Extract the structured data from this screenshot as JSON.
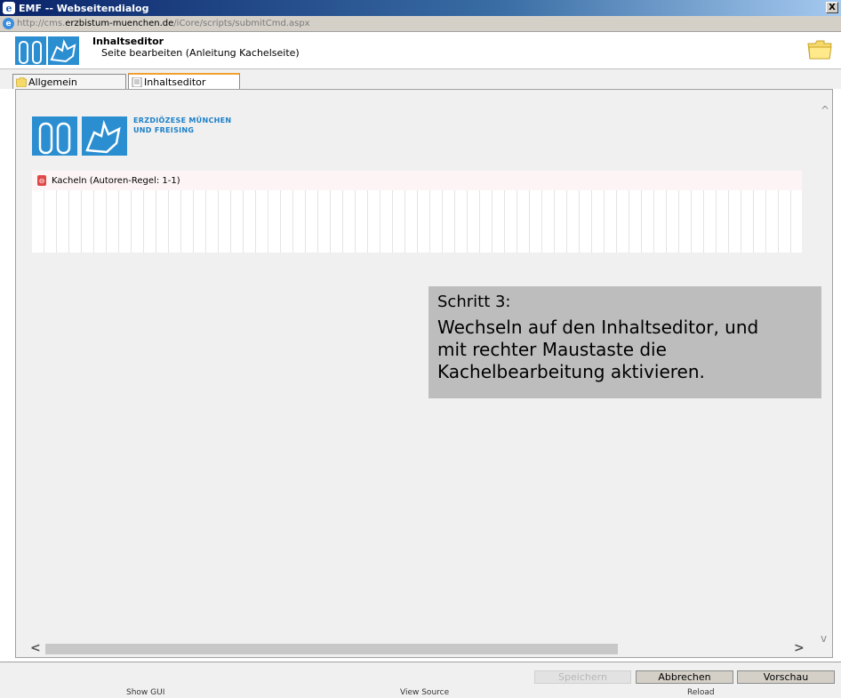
{
  "window": {
    "title": "EMF -- Webseitendialog",
    "close_glyph": "X",
    "url_prefix": "http://cms.",
    "url_domain": "erzbistum-muenchen.de",
    "url_path": "/iCore/scripts/submitCmd.aspx"
  },
  "header": {
    "title": "Inhaltseditor",
    "subtitle": "Seite bearbeiten (Anleitung Kachelseite)"
  },
  "tabs": [
    {
      "label": "Allgemein",
      "icon": "folder-icon"
    },
    {
      "label": "Inhaltseditor",
      "icon": "document-icon"
    }
  ],
  "content": {
    "org_line1": "ERZDIÖZESE MÜNCHEN",
    "org_line2": "UND FREISING",
    "tiles_label": "Kacheln (Autoren-Regel: 1-1)"
  },
  "overlay": {
    "title": "Schritt 3:",
    "body_line1": "Wechseln auf den Inhaltseditor, und",
    "body_line2": "mit rechter Maustaste die",
    "body_line3": "Kachelbearbeitung aktivieren."
  },
  "buttons": {
    "save": "Speichern",
    "cancel": "Abbrechen",
    "preview": "Vorschau"
  },
  "footer": {
    "show_gui": "Show GUI",
    "view_source": "View Source",
    "reload": "Reload"
  },
  "scroll": {
    "up_glyph": "^",
    "down_glyph": "v",
    "left_glyph": "<",
    "right_glyph": ">"
  },
  "colors": {
    "brand_blue": "#2b8ed1",
    "overlay_gray": "#bdbdbd",
    "tab_accent": "#f0a030"
  }
}
